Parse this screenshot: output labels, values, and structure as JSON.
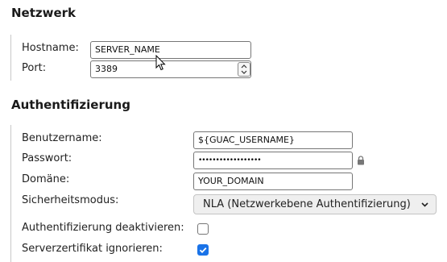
{
  "network": {
    "title": "Netzwerk",
    "hostname_label": "Hostname:",
    "hostname_value": "SERVER_NAME",
    "port_label": "Port:",
    "port_value": "3389"
  },
  "auth": {
    "title": "Authentifizierung",
    "username_label": "Benutzername:",
    "username_value": "${GUAC_USERNAME}",
    "password_label": "Passwort:",
    "password_value": "••••••••••••••••••",
    "domain_label": "Domäne:",
    "domain_value": "YOUR_DOMAIN",
    "security_label": "Sicherheitsmodus:",
    "security_value": "NLA (Netzwerkebene Authentifizierung)",
    "disable_auth_label": "Authentifizierung deaktivieren:",
    "disable_auth_checked": false,
    "ignore_cert_label": "Serverzertifikat ignorieren:",
    "ignore_cert_checked": true
  },
  "colors": {
    "checkbox_checked": "#1a73e8",
    "select_bg": "#efefef"
  },
  "icons": {
    "password_lock": "lock-icon",
    "select_chevron": "chevron-down-icon",
    "pointer": "mouse-cursor-icon"
  }
}
